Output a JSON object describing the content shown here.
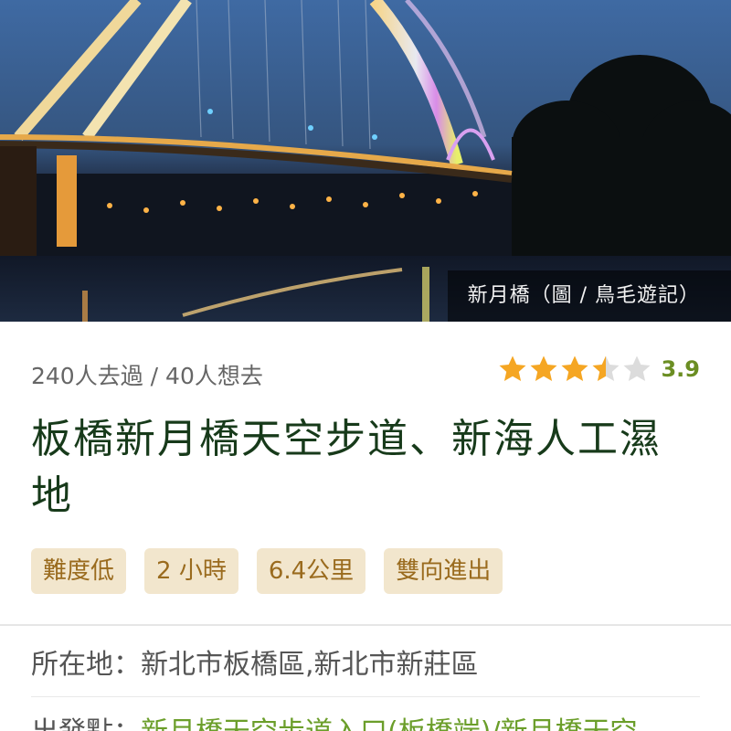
{
  "hero": {
    "caption": "新月橋（圖 / 鳥毛遊記）"
  },
  "stats": {
    "text": "240人去過 / 40人想去"
  },
  "rating": {
    "value": "3.9",
    "stars_filled": 3.5,
    "stars_total": 5,
    "star_color": "#f5a623",
    "empty_star_color": "#dcdcdc"
  },
  "title": "板橋新月橋天空步道、新海人工濕地",
  "tags": [
    "難度低",
    "2 小時",
    "6.4公里",
    "雙向進出"
  ],
  "location": {
    "text": "所在地：新北市板橋區,新北市新莊區"
  },
  "start": {
    "label": "出發點：",
    "value": "新月橋天空步道入口(板橋端)/新月橋天空"
  },
  "colors": {
    "title": "#173a1a",
    "tag_bg": "#f2e6cd",
    "tag_text": "#9a6b1e",
    "link": "#6b9e2a",
    "rating_value": "#6b8e23"
  }
}
